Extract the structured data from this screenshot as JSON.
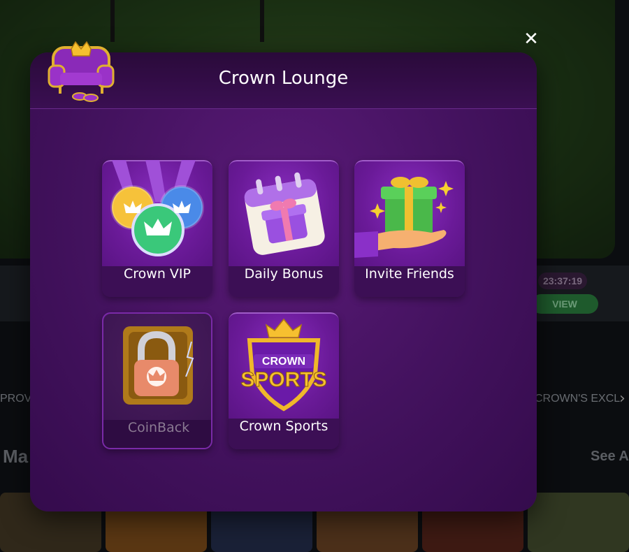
{
  "background": {
    "timer": "23:37:19",
    "view_label": "VIEW",
    "ticker_left": "PROVI",
    "ticker_right": "CROWN'S EXCL",
    "section_heading_partial": "Ma",
    "see_all_partial": "See A"
  },
  "modal": {
    "title": "Crown Lounge",
    "close_icon": "close-icon",
    "tiles": [
      {
        "label": "Crown VIP",
        "icon": "vip-medals-icon",
        "enabled": true
      },
      {
        "label": "Daily Bonus",
        "icon": "calendar-gift-icon",
        "enabled": true
      },
      {
        "label": "Invite Friends",
        "icon": "hand-gift-icon",
        "enabled": true
      },
      {
        "label": "CoinBack",
        "icon": "locked-coinback-icon",
        "enabled": false
      },
      {
        "label": "Crown Sports",
        "icon": "crown-sports-badge-icon",
        "enabled": true,
        "badge_line1": "CROWN",
        "badge_line2": "SPORTS"
      }
    ]
  },
  "colors": {
    "modal_bg": "#43125e",
    "tile_art": "#7a24b0",
    "tile_label_bg": "#3c0f55"
  }
}
